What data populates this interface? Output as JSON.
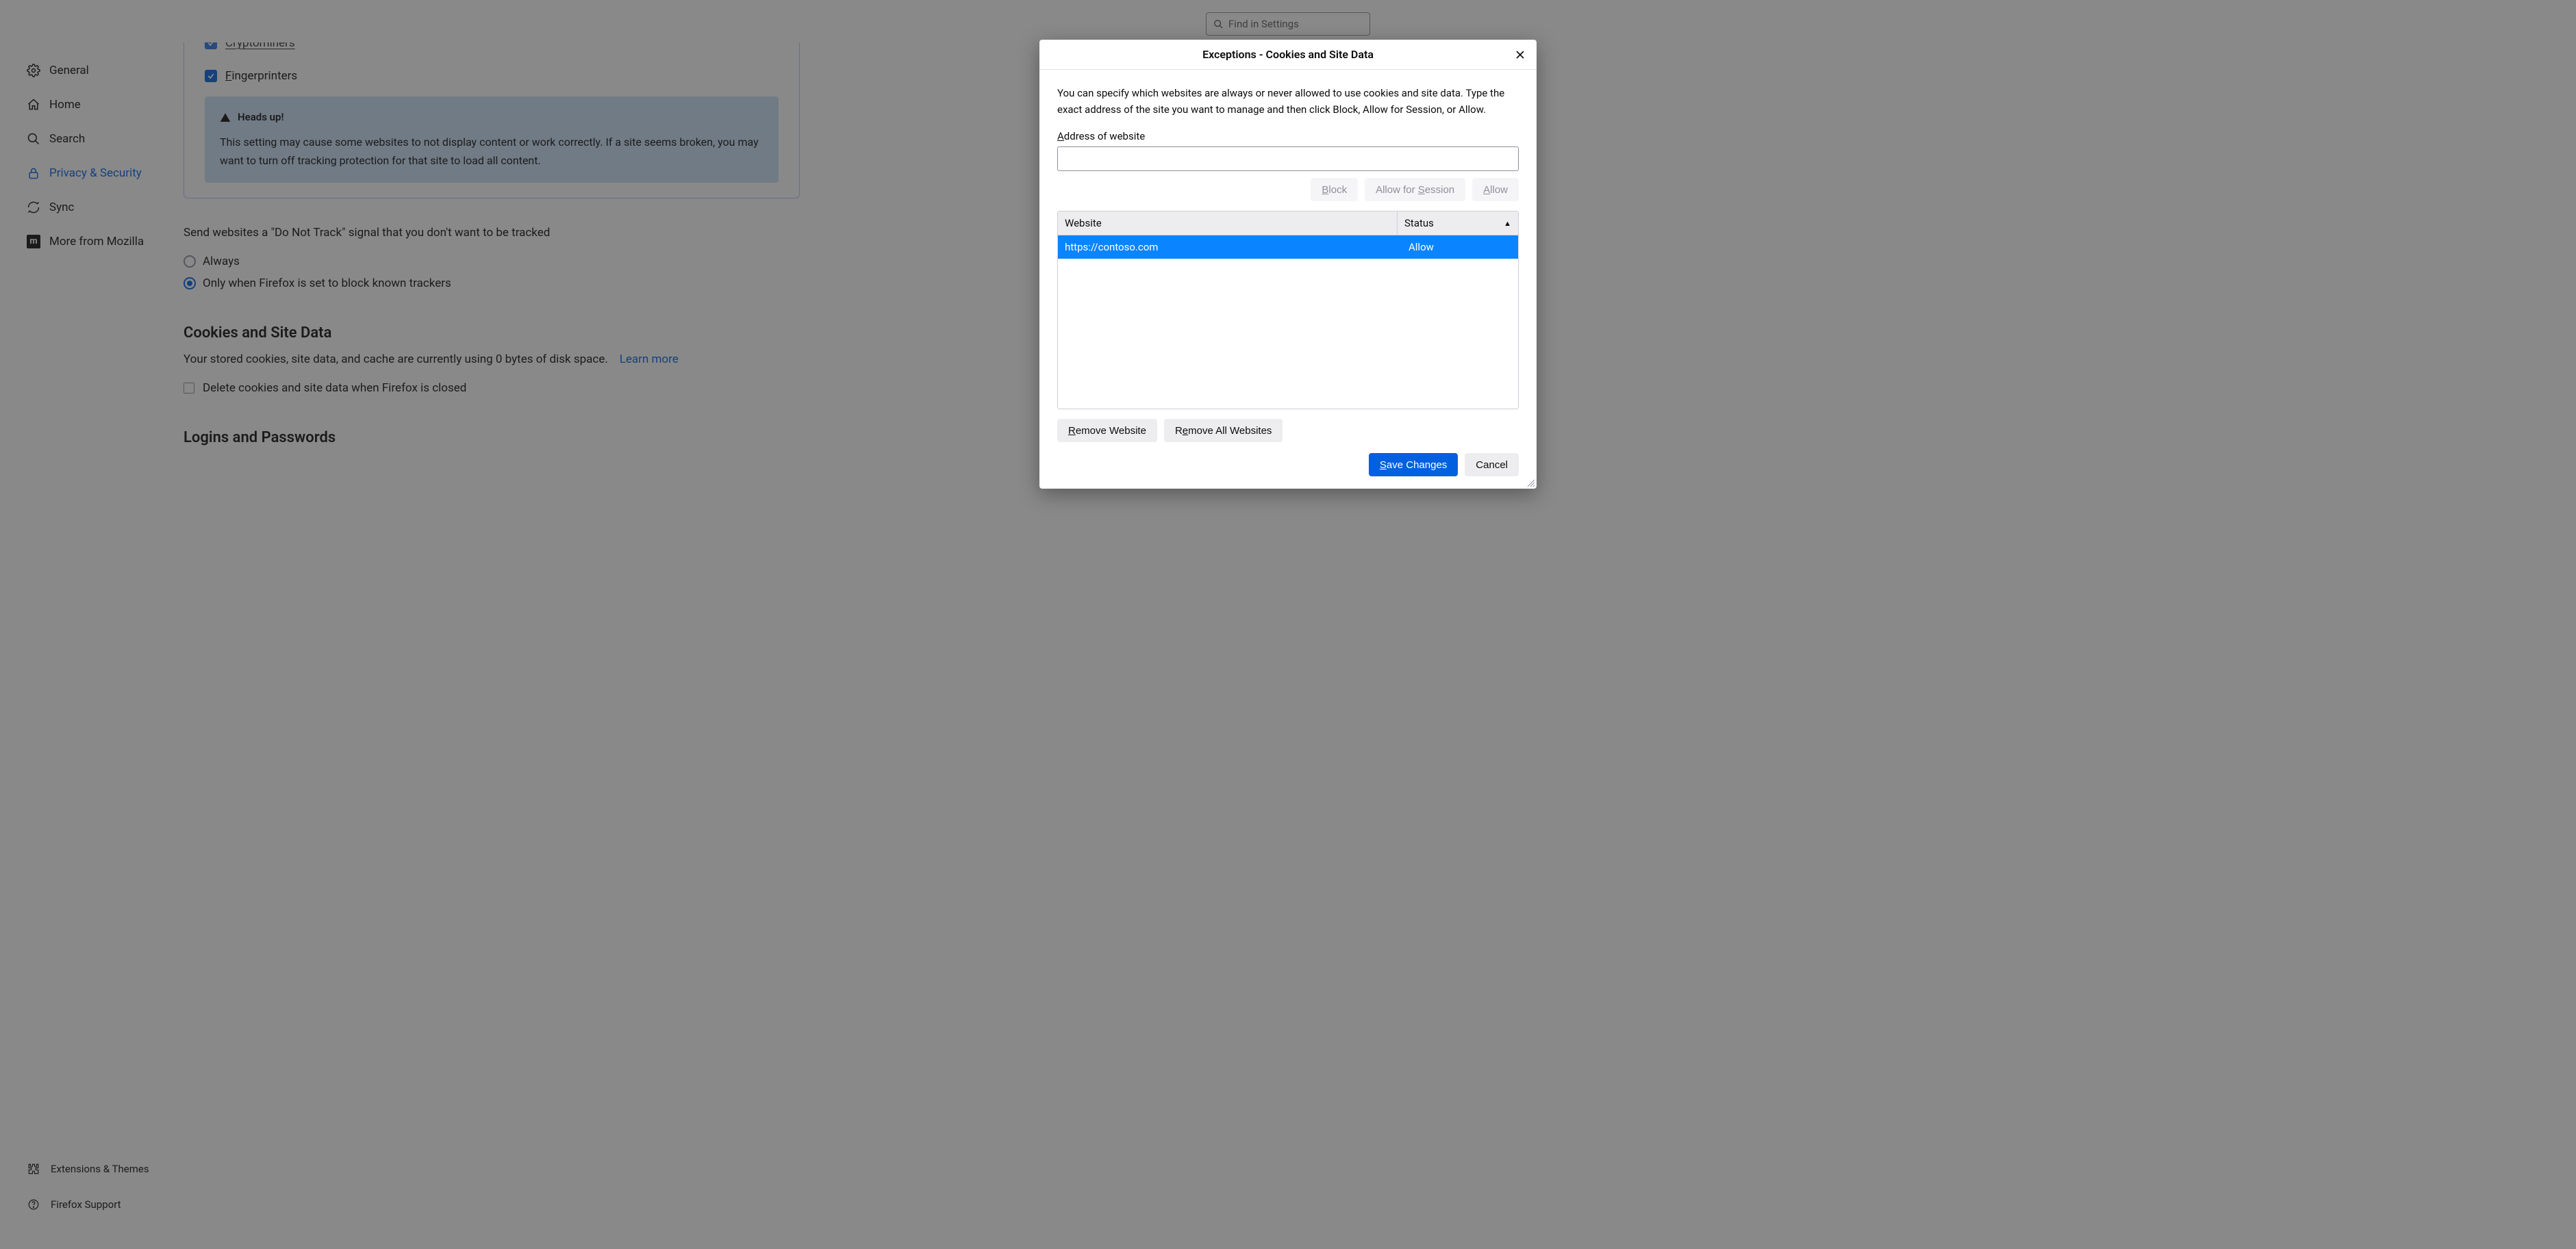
{
  "search": {
    "placeholder": "Find in Settings"
  },
  "sidebar": {
    "items": [
      {
        "label": "General"
      },
      {
        "label": "Home"
      },
      {
        "label": "Search"
      },
      {
        "label": "Privacy & Security"
      },
      {
        "label": "Sync"
      },
      {
        "label": "More from Mozilla"
      }
    ],
    "footer": [
      {
        "label": "Extensions & Themes"
      },
      {
        "label": "Firefox Support"
      }
    ]
  },
  "tracking": {
    "cryptominers": "Cryptominers",
    "fingerprinters": "Fingerprinters",
    "heads_up_title": "Heads up!",
    "heads_up_body": "This setting may cause some websites to not display content or work correctly. If a site seems broken, you may want to turn off tracking protection for that site to load all content."
  },
  "dnt": {
    "intro": "Send websites a \"Do Not Track\" signal that you don't want to be tracked",
    "always": "Always",
    "only_when": "Only when Firefox is set to block known trackers"
  },
  "cookies": {
    "title": "Cookies and Site Data",
    "body": "Your stored cookies, site data, and cache are currently using 0 bytes of disk space.",
    "learn_more": "Learn more",
    "delete_label": "Delete cookies and site data when Firefox is closed"
  },
  "logins": {
    "title": "Logins and Passwords"
  },
  "dialog": {
    "title": "Exceptions - Cookies and Site Data",
    "description": "You can specify which websites are always or never allowed to use cookies and site data. Type the exact address of the site you want to manage and then click Block, Allow for Session, or Allow.",
    "address_label": "Address of website",
    "address_value": "",
    "buttons": {
      "block": "Block",
      "allow_session_pre": "Allow for ",
      "allow_session_u": "S",
      "allow_session_post": "ession",
      "allow": "Allow",
      "remove_website": "Remove Website",
      "remove_all": "Remove All Websites",
      "save": "Save Changes",
      "cancel": "Cancel"
    },
    "columns": {
      "website": "Website",
      "status": "Status"
    },
    "rows": [
      {
        "website": "https://contoso.com",
        "status": "Allow"
      }
    ]
  }
}
